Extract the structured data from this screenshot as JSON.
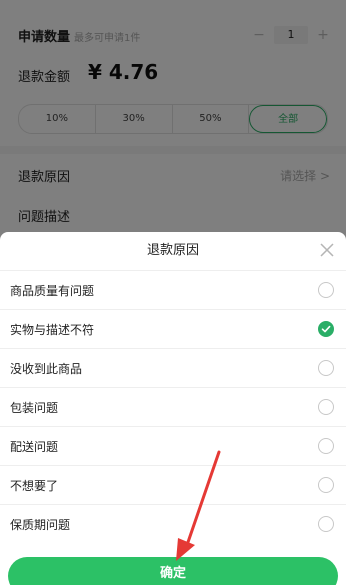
{
  "colors": {
    "accent": "#2aae67",
    "confirm": "#2cc166",
    "arrow": "#e53935"
  },
  "background": {
    "quantity_label": "申请数量",
    "quantity_hint": "最多可申请1件",
    "stepper": {
      "minus": "−",
      "value": "1",
      "plus": "+"
    },
    "refund_amount_label": "退款金额",
    "refund_amount": "¥ 4.76",
    "percent_options": [
      {
        "label": "10%"
      },
      {
        "label": "30%"
      },
      {
        "label": "50%"
      },
      {
        "label": "全部",
        "selected": true
      }
    ],
    "reason_label": "退款原因",
    "reason_placeholder": "请选择 >",
    "description_label": "问题描述"
  },
  "sheet": {
    "title": "退款原因",
    "close_icon": "close-icon",
    "options": [
      {
        "label": "商品质量有问题",
        "checked": false
      },
      {
        "label": "实物与描述不符",
        "checked": true
      },
      {
        "label": "没收到此商品",
        "checked": false
      },
      {
        "label": "包装问题",
        "checked": false
      },
      {
        "label": "配送问题",
        "checked": false
      },
      {
        "label": "不想要了",
        "checked": false
      },
      {
        "label": "保质期问题",
        "checked": false
      }
    ],
    "confirm_label": "确定"
  }
}
